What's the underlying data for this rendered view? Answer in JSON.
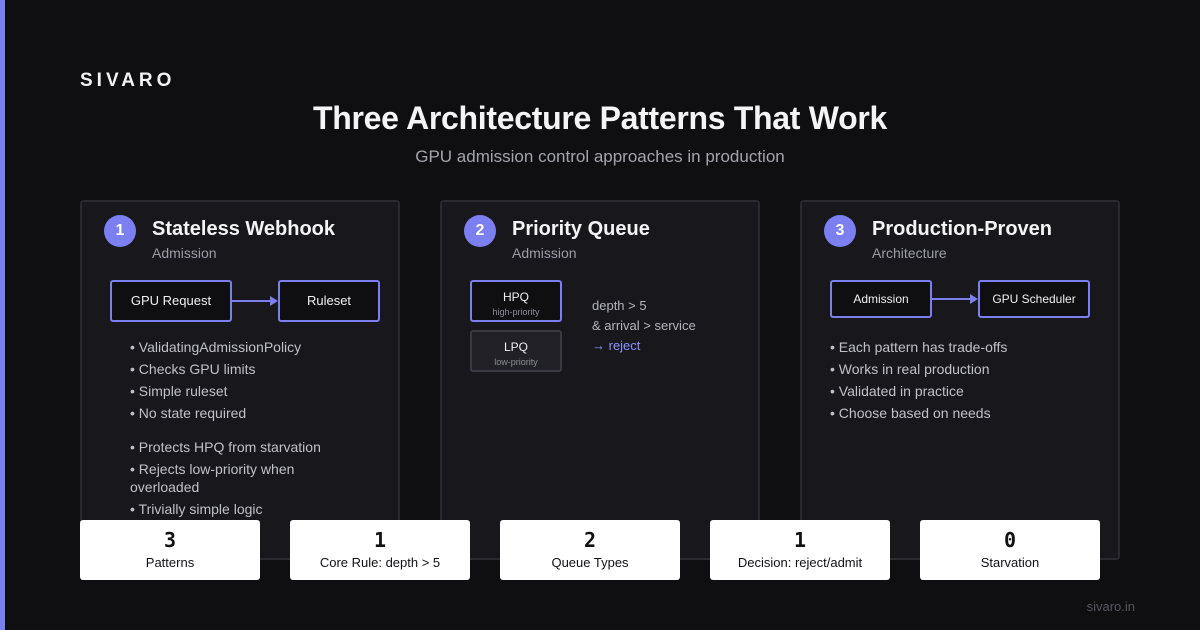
{
  "brand": "SIVARO",
  "title": "Three Architecture Patterns That Work",
  "subtitle": "GPU admission control approaches in production",
  "cards": [
    {
      "number": "1",
      "title": "Stateless Webhook",
      "subtitle": "Admission",
      "diagram": {
        "from": "GPU Request",
        "to": "Ruleset"
      },
      "bullets": [
        "ValidatingAdmissionPolicy",
        "Checks GPU limits",
        "Simple ruleset",
        "No state required"
      ],
      "bullets2": [
        "Protects HPQ from starvation",
        "Rejects low-priority when overloaded",
        "Trivially simple logic"
      ]
    },
    {
      "number": "2",
      "title": "Priority Queue",
      "subtitle": "Admission",
      "queues": [
        {
          "name": "HPQ",
          "desc": "high-priority"
        },
        {
          "name": "LPQ",
          "desc": "low-priority"
        }
      ],
      "rule": [
        "depth > 5",
        "& arrival > service",
        "→ reject"
      ]
    },
    {
      "number": "3",
      "title": "Production-Proven",
      "subtitle": "Architecture",
      "diagram": {
        "from": "Admission",
        "to": "GPU Scheduler"
      },
      "bullets": [
        "Each pattern has trade-offs",
        "Works in real production",
        "Validated in practice",
        "Choose based on needs"
      ]
    }
  ],
  "stats": [
    {
      "value": "3",
      "label": "Patterns"
    },
    {
      "value": "1",
      "label": "Core Rule: depth > 5"
    },
    {
      "value": "2",
      "label": "Queue Types"
    },
    {
      "value": "1",
      "label": "Decision: reject/admit"
    },
    {
      "value": "0",
      "label": "Starvation"
    }
  ],
  "footer": "sivaro.in",
  "colors": {
    "accent": "#7b7ff0",
    "background": "#0f0f11",
    "card": "#18181c",
    "reject": "#8e92ff"
  }
}
